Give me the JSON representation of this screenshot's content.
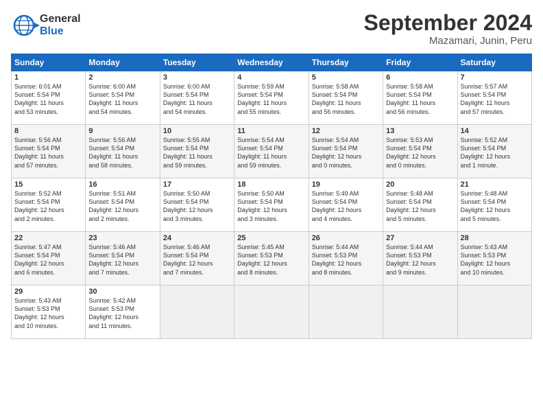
{
  "logo": {
    "line1": "General",
    "line2": "Blue"
  },
  "title": "September 2024",
  "subtitle": "Mazamari, Junin, Peru",
  "weekdays": [
    "Sunday",
    "Monday",
    "Tuesday",
    "Wednesday",
    "Thursday",
    "Friday",
    "Saturday"
  ],
  "weeks": [
    [
      {
        "day": "1",
        "info": "Sunrise: 6:01 AM\nSunset: 5:54 PM\nDaylight: 11 hours\nand 53 minutes."
      },
      {
        "day": "2",
        "info": "Sunrise: 6:00 AM\nSunset: 5:54 PM\nDaylight: 11 hours\nand 54 minutes."
      },
      {
        "day": "3",
        "info": "Sunrise: 6:00 AM\nSunset: 5:54 PM\nDaylight: 11 hours\nand 54 minutes."
      },
      {
        "day": "4",
        "info": "Sunrise: 5:59 AM\nSunset: 5:54 PM\nDaylight: 11 hours\nand 55 minutes."
      },
      {
        "day": "5",
        "info": "Sunrise: 5:58 AM\nSunset: 5:54 PM\nDaylight: 11 hours\nand 56 minutes."
      },
      {
        "day": "6",
        "info": "Sunrise: 5:58 AM\nSunset: 5:54 PM\nDaylight: 11 hours\nand 56 minutes."
      },
      {
        "day": "7",
        "info": "Sunrise: 5:57 AM\nSunset: 5:54 PM\nDaylight: 11 hours\nand 57 minutes."
      }
    ],
    [
      {
        "day": "8",
        "info": "Sunrise: 5:56 AM\nSunset: 5:54 PM\nDaylight: 11 hours\nand 57 minutes."
      },
      {
        "day": "9",
        "info": "Sunrise: 5:56 AM\nSunset: 5:54 PM\nDaylight: 11 hours\nand 58 minutes."
      },
      {
        "day": "10",
        "info": "Sunrise: 5:55 AM\nSunset: 5:54 PM\nDaylight: 11 hours\nand 59 minutes."
      },
      {
        "day": "11",
        "info": "Sunrise: 5:54 AM\nSunset: 5:54 PM\nDaylight: 11 hours\nand 59 minutes."
      },
      {
        "day": "12",
        "info": "Sunrise: 5:54 AM\nSunset: 5:54 PM\nDaylight: 12 hours\nand 0 minutes."
      },
      {
        "day": "13",
        "info": "Sunrise: 5:53 AM\nSunset: 5:54 PM\nDaylight: 12 hours\nand 0 minutes."
      },
      {
        "day": "14",
        "info": "Sunrise: 5:52 AM\nSunset: 5:54 PM\nDaylight: 12 hours\nand 1 minute."
      }
    ],
    [
      {
        "day": "15",
        "info": "Sunrise: 5:52 AM\nSunset: 5:54 PM\nDaylight: 12 hours\nand 2 minutes."
      },
      {
        "day": "16",
        "info": "Sunrise: 5:51 AM\nSunset: 5:54 PM\nDaylight: 12 hours\nand 2 minutes."
      },
      {
        "day": "17",
        "info": "Sunrise: 5:50 AM\nSunset: 5:54 PM\nDaylight: 12 hours\nand 3 minutes."
      },
      {
        "day": "18",
        "info": "Sunrise: 5:50 AM\nSunset: 5:54 PM\nDaylight: 12 hours\nand 3 minutes."
      },
      {
        "day": "19",
        "info": "Sunrise: 5:49 AM\nSunset: 5:54 PM\nDaylight: 12 hours\nand 4 minutes."
      },
      {
        "day": "20",
        "info": "Sunrise: 5:48 AM\nSunset: 5:54 PM\nDaylight: 12 hours\nand 5 minutes."
      },
      {
        "day": "21",
        "info": "Sunrise: 5:48 AM\nSunset: 5:54 PM\nDaylight: 12 hours\nand 5 minutes."
      }
    ],
    [
      {
        "day": "22",
        "info": "Sunrise: 5:47 AM\nSunset: 5:54 PM\nDaylight: 12 hours\nand 6 minutes."
      },
      {
        "day": "23",
        "info": "Sunrise: 5:46 AM\nSunset: 5:54 PM\nDaylight: 12 hours\nand 7 minutes."
      },
      {
        "day": "24",
        "info": "Sunrise: 5:46 AM\nSunset: 5:54 PM\nDaylight: 12 hours\nand 7 minutes."
      },
      {
        "day": "25",
        "info": "Sunrise: 5:45 AM\nSunset: 5:53 PM\nDaylight: 12 hours\nand 8 minutes."
      },
      {
        "day": "26",
        "info": "Sunrise: 5:44 AM\nSunset: 5:53 PM\nDaylight: 12 hours\nand 8 minutes."
      },
      {
        "day": "27",
        "info": "Sunrise: 5:44 AM\nSunset: 5:53 PM\nDaylight: 12 hours\nand 9 minutes."
      },
      {
        "day": "28",
        "info": "Sunrise: 5:43 AM\nSunset: 5:53 PM\nDaylight: 12 hours\nand 10 minutes."
      }
    ],
    [
      {
        "day": "29",
        "info": "Sunrise: 5:43 AM\nSunset: 5:53 PM\nDaylight: 12 hours\nand 10 minutes."
      },
      {
        "day": "30",
        "info": "Sunrise: 5:42 AM\nSunset: 5:53 PM\nDaylight: 12 hours\nand 11 minutes."
      },
      {
        "day": "",
        "info": ""
      },
      {
        "day": "",
        "info": ""
      },
      {
        "day": "",
        "info": ""
      },
      {
        "day": "",
        "info": ""
      },
      {
        "day": "",
        "info": ""
      }
    ]
  ]
}
